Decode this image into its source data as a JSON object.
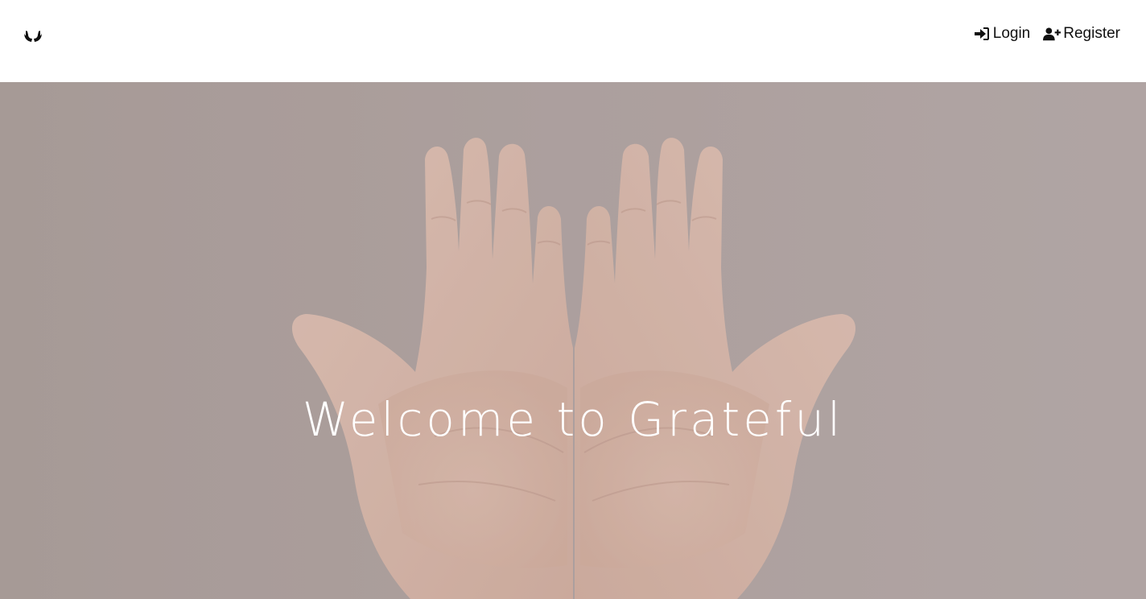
{
  "navbar": {
    "brand_icon": "hands-holding-icon",
    "links": [
      {
        "label": "Login",
        "icon": "sign-in-icon"
      },
      {
        "label": "Register",
        "icon": "user-plus-icon"
      }
    ]
  },
  "hero": {
    "title": "Welcome to Grateful",
    "background_image": "two open cupped hands",
    "title_color": "#ffffff"
  },
  "colors": {
    "navbar_bg": "#ffffff",
    "nav_text": "#111111",
    "hero_bg": "#b2a3a2",
    "skin": "#e2bfb0"
  }
}
